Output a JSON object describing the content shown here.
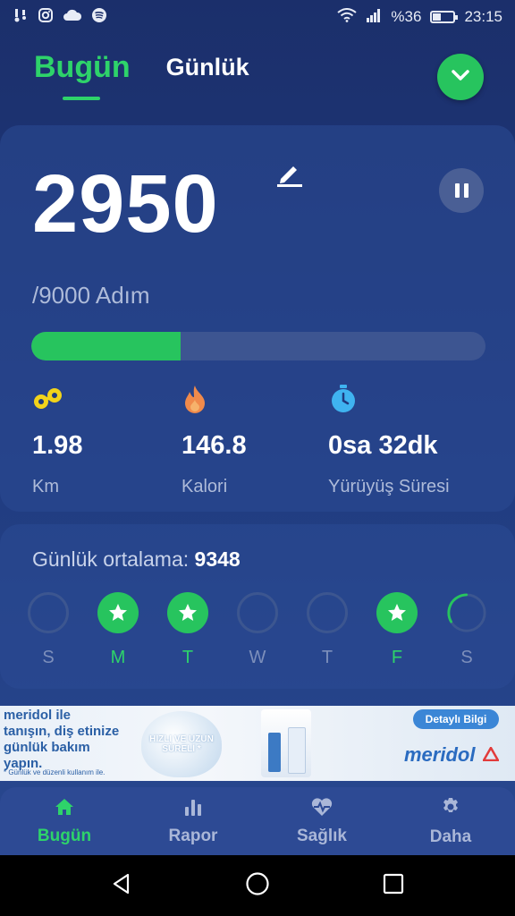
{
  "status_bar": {
    "battery": "%36",
    "time": "23:15",
    "icons": [
      "notification-icon",
      "instagram-icon",
      "cloud-icon",
      "spotify-icon",
      "wifi-icon",
      "signal-icon",
      "battery-icon"
    ]
  },
  "header": {
    "tab_today": "Bugün",
    "tab_daily": "Günlük",
    "dropdown_icon": "chevron-down-icon"
  },
  "steps": {
    "value": "2950",
    "goal": "/9000 Adım",
    "progress_fraction": 0.3278
  },
  "stats": [
    {
      "icon": "distance-icon",
      "value": "1.98",
      "label": "Km"
    },
    {
      "icon": "flame-icon",
      "value": "146.8",
      "label": "Kalori"
    },
    {
      "icon": "stopwatch-icon",
      "value": "0sa 32dk",
      "label": "Yürüyüş Süresi"
    }
  ],
  "weekly": {
    "avg_label": "Günlük ortalama:",
    "avg_value": "9348",
    "days": [
      {
        "label": "S",
        "state": "empty"
      },
      {
        "label": "M",
        "state": "done"
      },
      {
        "label": "T",
        "state": "done"
      },
      {
        "label": "W",
        "state": "empty"
      },
      {
        "label": "T",
        "state": "empty"
      },
      {
        "label": "F",
        "state": "done"
      },
      {
        "label": "S",
        "state": "in-progress",
        "progress_fraction": 0.33
      }
    ]
  },
  "ad": {
    "text_left": "meridol ile tanışın, diş etinize günlük bakım yapın.",
    "fine_print": "* Günlük ve düzenli kullanım ile.",
    "drop_text": "HIZLI VE UZUN SÜRELİ *",
    "cta": "Detaylı Bilgi",
    "brand": "meridol"
  },
  "bottom_nav": [
    {
      "icon": "home-icon",
      "label": "Bugün",
      "active": true
    },
    {
      "icon": "bar-chart-icon",
      "label": "Rapor",
      "active": false
    },
    {
      "icon": "heart-pulse-icon",
      "label": "Sağlık",
      "active": false
    },
    {
      "icon": "gear-icon",
      "label": "Daha",
      "active": false
    }
  ],
  "colors": {
    "accent": "#27c45e",
    "background": "#1f3a7e",
    "muted_text": "#aebbd9"
  }
}
